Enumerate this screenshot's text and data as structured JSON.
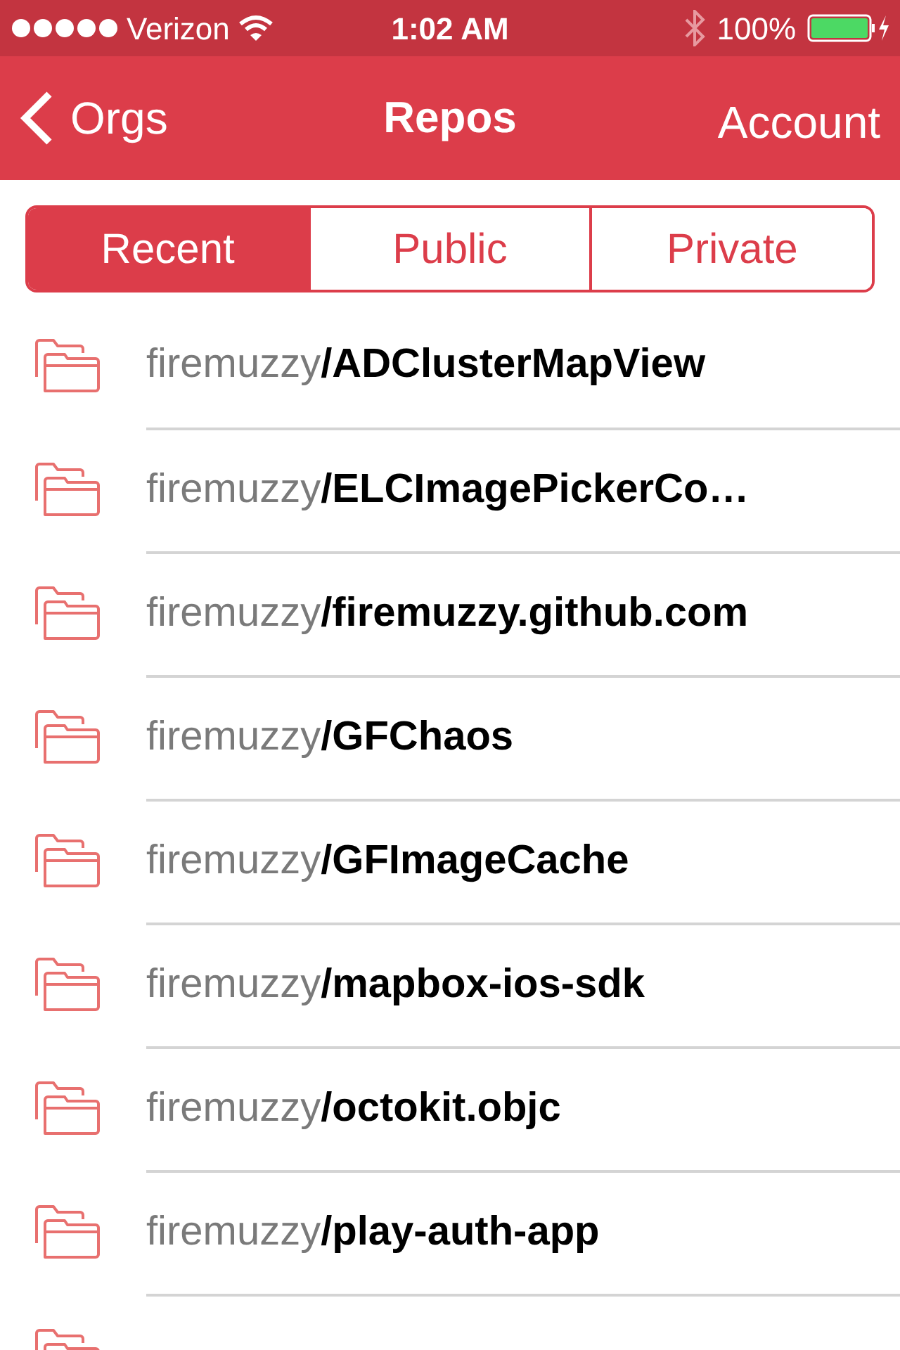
{
  "status_bar": {
    "carrier": "Verizon",
    "time": "1:02 AM",
    "battery": "100%"
  },
  "nav_bar": {
    "back": "Orgs",
    "title": "Repos",
    "action": "Account"
  },
  "tabs": [
    {
      "label": "Recent",
      "selected": true
    },
    {
      "label": "Public",
      "selected": false
    },
    {
      "label": "Private",
      "selected": false
    }
  ],
  "repos": [
    {
      "kind": "row",
      "label": "firemuzzy**/ADClusterMapView**"
    },
    {
      "kind": "row",
      "label": "firemuzzy**/ELCImagePickerCo…**"
    },
    {
      "kind": "row",
      "label": "firemuzzy**/firemuzzy.github.com**"
    },
    {
      "kind": "row",
      "label": "firemuzzy**/GFChaos**"
    },
    {
      "kind": "row",
      "label": "firemuzzy**/GFImageCache**"
    },
    {
      "kind": "row",
      "label": "firemuzzy**/mapbox-ios-sdk**"
    },
    {
      "kind": "row",
      "label": "firemuzzy**/octokit.objc**"
    },
    {
      "kind": "row",
      "label": "firemuzzy**/play-auth-app**"
    },
    {
      "kind": "cut"
    }
  ]
}
